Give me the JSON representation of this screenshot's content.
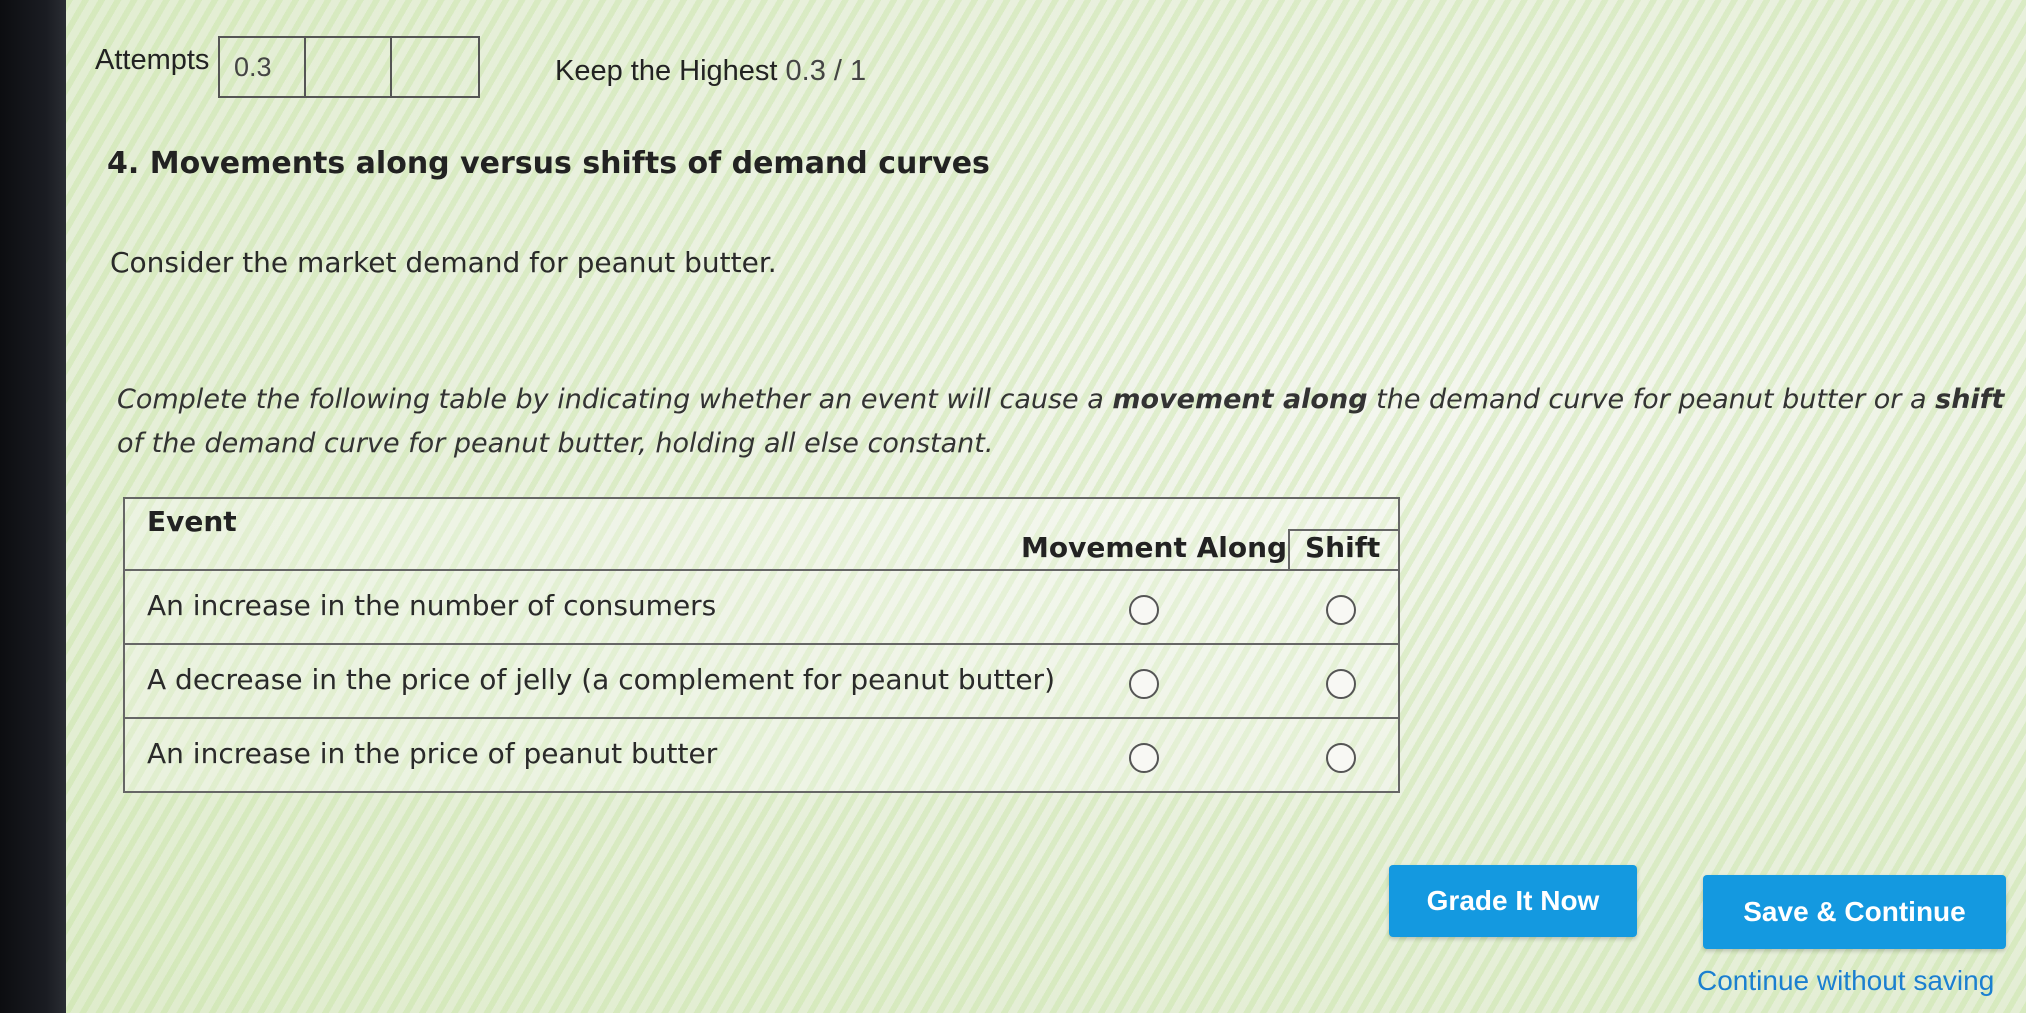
{
  "attempts": {
    "label": "Attempts",
    "boxes": [
      "0.3",
      "",
      ""
    ]
  },
  "score": {
    "keep_label": "Keep the Highest",
    "value": "0.3 / 1"
  },
  "question": {
    "title": "4. Movements along versus shifts of demand curves",
    "intro": "Consider the market demand for peanut butter.",
    "instructions": {
      "part1": "Complete the following table by indicating whether an event will cause a ",
      "bold1": "movement along",
      "part2": " the demand curve for peanut butter or a ",
      "bold2": "shift",
      "part3": " of the demand curve for peanut butter, holding all else constant."
    }
  },
  "table": {
    "headers": {
      "event": "Event",
      "movement": "Movement Along",
      "shift": "Shift"
    },
    "rows": [
      {
        "event": "An increase in the number of consumers",
        "selected": null
      },
      {
        "event": "A decrease in the price of jelly (a complement for peanut butter)",
        "selected": null
      },
      {
        "event": "An increase in the price of peanut butter",
        "selected": null
      }
    ]
  },
  "buttons": {
    "grade": "Grade It Now",
    "save": "Save & Continue",
    "continue_without": "Continue without saving"
  },
  "colors": {
    "button_bg": "#1499e0",
    "link": "#1b7fd0"
  }
}
